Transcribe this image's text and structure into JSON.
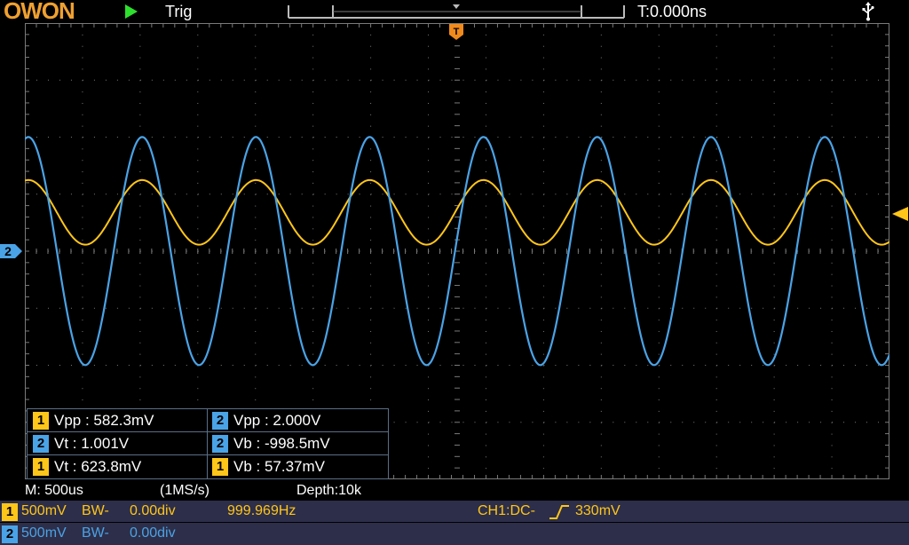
{
  "header": {
    "logo_text": "OWON",
    "run_icon": "play-icon",
    "trigger_status": "Trig",
    "trigger_position": "T:0.000ns",
    "usb_icon": "usb-icon"
  },
  "colors": {
    "ch1": "#ffc61a",
    "ch2": "#4aa3e6",
    "grid": "#7a7a7a",
    "trigger_marker": "#f08a1c",
    "panel_bg": "#2d2e49"
  },
  "markers": {
    "trigger_time_marker_label": "T",
    "ch2_ground_marker_label": "2"
  },
  "measurements": [
    {
      "channel": "1",
      "label": "Vpp",
      "value": "582.3mV",
      "text": "Vpp : 582.3mV"
    },
    {
      "channel": "2",
      "label": "Vpp",
      "value": "2.000V",
      "text": "Vpp : 2.000V"
    },
    {
      "channel": "2",
      "label": "Vt",
      "value": "1.001V",
      "text": "Vt : 1.001V"
    },
    {
      "channel": "2",
      "label": "Vb",
      "value": "-998.5mV",
      "text": "Vb : -998.5mV"
    },
    {
      "channel": "1",
      "label": "Vt",
      "value": "623.8mV",
      "text": "Vt : 623.8mV"
    },
    {
      "channel": "1",
      "label": "Vb",
      "value": "57.37mV",
      "text": "Vb : 57.37mV"
    }
  ],
  "status": {
    "timebase": "M: 500us",
    "sample_rate": "(1MS/s)",
    "depth": "Depth:10k"
  },
  "channel_rows": [
    {
      "badge": "1",
      "scale": "500mV",
      "bw": "BW-",
      "offset": "0.00div",
      "frequency": "999.969Hz",
      "trigger": "CH1:DC-",
      "trigger_edge_icon": "rising-edge-icon",
      "trigger_level": "330mV"
    },
    {
      "badge": "2",
      "scale": "500mV",
      "bw": "BW-",
      "offset": "0.00div"
    }
  ],
  "waveforms": {
    "frequency_hz": 999.969,
    "volts_per_div": 0.5,
    "ch1": {
      "vmax": 0.6238,
      "vmin": 0.05737
    },
    "ch2": {
      "vmax": 1.001,
      "vmin": -0.9985
    }
  }
}
